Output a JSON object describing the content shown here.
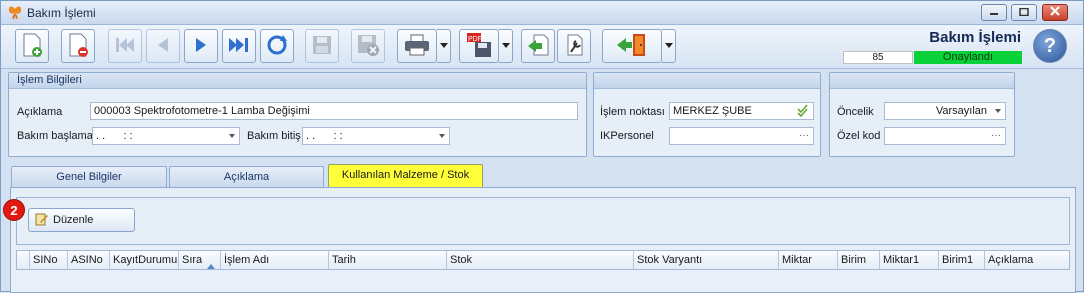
{
  "window": {
    "title": "Bakım İşlemi"
  },
  "header": {
    "module_title": "Bakım İşlemi",
    "count": "85",
    "status": "Onaylandı",
    "status_color": "#08d13a"
  },
  "toolbar": {
    "icons": [
      "new-document-icon",
      "delete-document-icon",
      "first-record-icon",
      "previous-record-icon",
      "next-record-icon",
      "last-record-icon",
      "refresh-icon",
      "save-icon",
      "save-close-icon",
      "print-icon",
      "pdf-export-icon",
      "import-icon",
      "tools-icon",
      "exit-icon",
      "help-icon"
    ]
  },
  "islem_bilgileri": {
    "heading": "İşlem Bilgileri",
    "aciklama_label": "Açıklama",
    "aciklama_value": "000003 Spektrofotometre-1 Lamba Değişimi",
    "bakim_baslama_label": "Bakım başlama",
    "bakim_baslama_value": ". .      : :",
    "bakim_bitis_label": "Bakım bitiş",
    "bakim_bitis_value": ". .      : :"
  },
  "islem_noktasi_group": {
    "islem_noktasi_label": "İşlem noktası",
    "islem_noktasi_value": "MERKEZ ŞUBE",
    "ik_personel_label": "IKPersonel",
    "ik_personel_value": "",
    "ellipsis": "···"
  },
  "oncelik_group": {
    "oncelik_label": "Öncelik",
    "oncelik_value": "Varsayılan",
    "ozel_kod_label": "Özel kod",
    "ozel_kod_value": ""
  },
  "tabs": [
    {
      "label": "Genel Bilgiler"
    },
    {
      "label": "Açıklama"
    },
    {
      "label": "Kullanılan Malzeme / Stok"
    }
  ],
  "panel": {
    "badge": "2",
    "edit_button": "Düzenle"
  },
  "grid": {
    "columns": [
      "SINo",
      "ASINo",
      "KayıtDurumu",
      "Sıra",
      "İşlem Adı",
      "Tarih",
      "Stok",
      "Stok Varyantı",
      "Miktar",
      "Birim",
      "Miktar1",
      "Birim1",
      "Açıklama"
    ]
  }
}
